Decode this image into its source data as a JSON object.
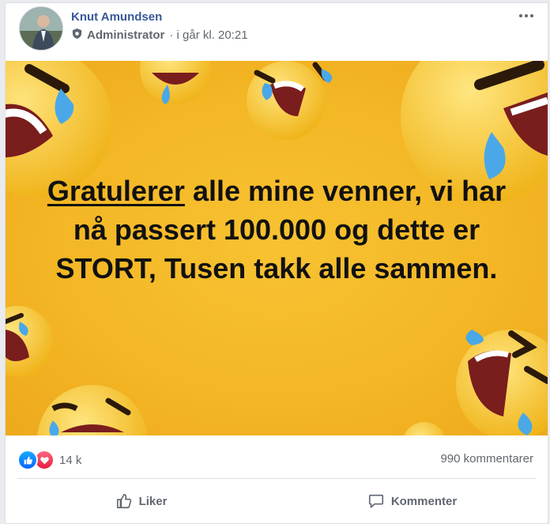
{
  "post": {
    "author": "Knut Amundsen",
    "role": "Administrator",
    "separator": "·",
    "timestamp": "i går kl. 20:21",
    "text_underlined": "Gratulerer",
    "text_rest": " alle mine venner, vi har nå passert 100.000 og dette er STORT, Tusen takk alle sammen."
  },
  "stats": {
    "reaction_count": "14 k",
    "comment_count": "990 kommentarer"
  },
  "actions": {
    "like_label": "Liker",
    "comment_label": "Kommenter"
  },
  "colors": {
    "author_link": "#385898",
    "image_background": "#f4b725",
    "like_reaction": "#0866ff",
    "love_reaction": "#e61e3f"
  },
  "icons": [
    "admin-badge-icon",
    "more-options-icon",
    "like-reaction-icon",
    "love-reaction-icon",
    "thumbs-up-icon",
    "comment-bubble-icon"
  ]
}
